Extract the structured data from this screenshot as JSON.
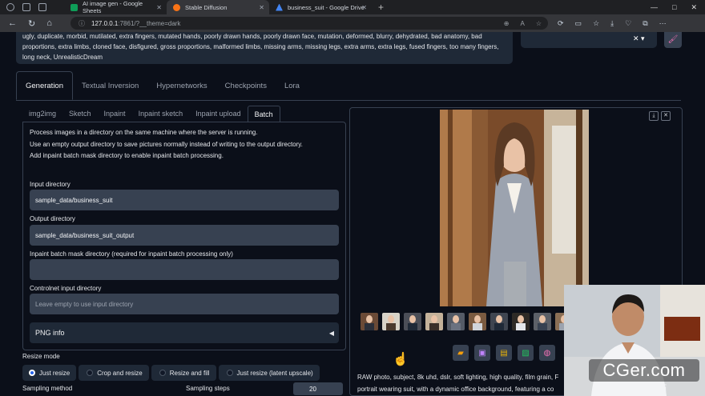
{
  "browser": {
    "tabs": [
      {
        "title": "AI image gen - Google Sheets",
        "color": "#0f9d58"
      },
      {
        "title": "Stable Diffusion",
        "color": "#f97316"
      },
      {
        "title": "business_suit - Google Drive",
        "color": "#4285f4"
      }
    ],
    "url_host": "127.0.0.1",
    "url_rest": ":7861/?__theme=dark",
    "new_tab": "+",
    "window_controls": [
      "—",
      "□",
      "✕"
    ]
  },
  "negative_prompt": "ugly, duplicate, morbid, mutilated, extra fingers, mutated hands, poorly drawn hands, poorly drawn face, mutation, deformed, blurry, dehydrated, bad anatomy, bad proportions, extra limbs, cloned face, disfigured, gross proportions, malformed limbs, missing arms, missing legs, extra arms, extra legs, fused fingers, too many fingers, long neck, UnrealisticDream",
  "main_tabs": [
    "Generation",
    "Textual Inversion",
    "Hypernetworks",
    "Checkpoints",
    "Lora"
  ],
  "sub_tabs": [
    "img2img",
    "Sketch",
    "Inpaint",
    "Inpaint sketch",
    "Inpaint upload",
    "Batch"
  ],
  "batch_info": [
    "Process images in a directory on the same machine where the server is running.",
    "Use an empty output directory to save pictures normally instead of writing to the output directory.",
    "Add inpaint batch mask directory to enable inpaint batch processing."
  ],
  "fields": {
    "input_label": "Input directory",
    "input_value": "sample_data/business_suit",
    "output_label": "Output directory",
    "output_value": "sample_data/business_suit_output",
    "mask_label": "Inpaint batch mask directory (required for inpaint batch processing only)",
    "mask_value": "",
    "controlnet_label": "Controlnet input directory",
    "controlnet_placeholder": "Leave empty to use input directory"
  },
  "png_info": "PNG info",
  "resize_mode": {
    "label": "Resize mode",
    "options": [
      "Just resize",
      "Crop and resize",
      "Resize and fill",
      "Just resize (latent upscale)"
    ],
    "selected": "Just resize"
  },
  "sampling_method_label": "Sampling method",
  "sampling_steps_label": "Sampling steps",
  "sampling_steps_value": "20",
  "output_prompt": "RAW photo, subject, 8k uhd, dslr, soft lighting, high quality, film grain, F portrait wearing suit, with a dynamic office background, featuring a co",
  "watermark": {
    "main": "CGer.com",
    "sub": "CG资源 CG网站"
  },
  "action_icons": [
    "folder-icon",
    "save-icon",
    "zip-icon",
    "image-icon",
    "palette-icon"
  ],
  "colors": {
    "accent": "#2563eb",
    "bg": "#0b0f19",
    "panel": "#1f2937",
    "input": "#374151"
  }
}
